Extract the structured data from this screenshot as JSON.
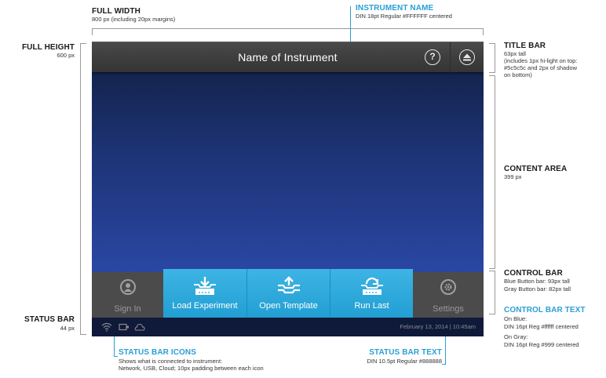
{
  "annotations": {
    "full_width": {
      "title": "FULL WIDTH",
      "text": "800 px (including 20px margins)"
    },
    "instrument_name": {
      "title": "INSTRUMENT NAME",
      "text": "DIN 18pt Regular #FFFFFF centered"
    },
    "full_height": {
      "title": "FULL HEIGHT",
      "text": "600 px"
    },
    "title_bar": {
      "title": "TITLE BAR",
      "line1": "63px tall",
      "line2": "(includes 1px hi-light on top:",
      "line3": "#5c5c5c and 2px of shadow",
      "line4": "on bottom)"
    },
    "content_area": {
      "title": "CONTENT AREA",
      "text": "399 px"
    },
    "control_bar": {
      "title": "CONTROL BAR",
      "line1": "Blue Button bar: 93px tall",
      "line2": "Gray Button bar: 82px tall"
    },
    "control_bar_text": {
      "title": "CONTROL BAR TEXT",
      "line1": "On Blue:",
      "line2": "DIN 16pt Reg #ffffff centered",
      "line3": "On Gray:",
      "line4": "DIN 16pt Reg #999 centered"
    },
    "status_bar": {
      "title": "STATUS BAR",
      "text": "44 px"
    },
    "status_bar_icons": {
      "title": "STATUS BAR ICONS",
      "line1": "Shows what is connected to instrument:",
      "line2": "Network, USB, Cloud; 10px padding between each icon"
    },
    "status_bar_text": {
      "title": "STATUS BAR TEXT",
      "text": "DIN 10.5pt Regular #888888"
    }
  },
  "screen": {
    "instrument_name": "Name of Instrument",
    "help_glyph": "?",
    "controls": {
      "sign_in": "Sign In",
      "load_experiment": "Load Experiment",
      "open_template": "Open Template",
      "run_last": "Run Last",
      "settings": "Settings"
    },
    "status": {
      "datetime": "February 13, 2014  |  10:45am",
      "icons": [
        "wifi-icon",
        "usb-icon",
        "cloud-icon"
      ]
    },
    "colors": {
      "title_bar": "#3c3c3c",
      "title_highlight": "#5c5c5c",
      "content_top": "#14244f",
      "content_bottom": "#2a47a3",
      "gray_button_bar": "#4b4b4b",
      "blue_button_bar": "#2ba6da",
      "status_bar": "#0f1a3a",
      "gray_text": "#999999",
      "status_text": "#888888",
      "annotation_accent": "#2a9fd6"
    }
  }
}
